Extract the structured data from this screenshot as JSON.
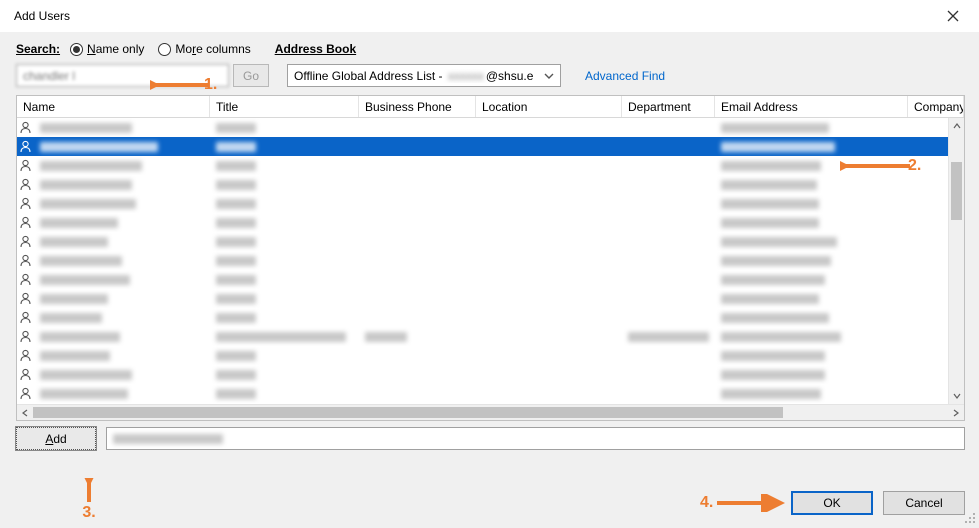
{
  "window": {
    "title": "Add Users"
  },
  "search": {
    "label": "Search:",
    "name_only": "Name only",
    "more_cols": "More columns",
    "address_book_label": "Address Book",
    "input_value": "chandler l",
    "go_label": "Go",
    "ab_select_prefix": "Offline Global Address List - ",
    "ab_select_suffix": "@shsu.e",
    "advanced": "Advanced Find"
  },
  "columns": {
    "name": "Name",
    "title": "Title",
    "phone": "Business Phone",
    "location": "Location",
    "department": "Department",
    "email": "Email Address",
    "company": "Company"
  },
  "rows": [
    {
      "selected": false,
      "widths": {
        "name": 92,
        "title": 40,
        "phone": 0,
        "loc": 0,
        "dept": 0,
        "email": 108
      }
    },
    {
      "selected": true,
      "widths": {
        "name": 118,
        "title": 40,
        "phone": 0,
        "loc": 0,
        "dept": 0,
        "email": 114
      }
    },
    {
      "selected": false,
      "widths": {
        "name": 102,
        "title": 40,
        "phone": 0,
        "loc": 0,
        "dept": 0,
        "email": 100
      }
    },
    {
      "selected": false,
      "widths": {
        "name": 92,
        "title": 40,
        "phone": 0,
        "loc": 0,
        "dept": 0,
        "email": 96
      }
    },
    {
      "selected": false,
      "widths": {
        "name": 96,
        "title": 40,
        "phone": 0,
        "loc": 0,
        "dept": 0,
        "email": 98
      }
    },
    {
      "selected": false,
      "widths": {
        "name": 78,
        "title": 40,
        "phone": 0,
        "loc": 0,
        "dept": 0,
        "email": 98
      }
    },
    {
      "selected": false,
      "widths": {
        "name": 68,
        "title": 40,
        "phone": 0,
        "loc": 0,
        "dept": 0,
        "email": 116
      }
    },
    {
      "selected": false,
      "widths": {
        "name": 82,
        "title": 40,
        "phone": 0,
        "loc": 0,
        "dept": 0,
        "email": 110
      }
    },
    {
      "selected": false,
      "widths": {
        "name": 90,
        "title": 40,
        "phone": 0,
        "loc": 0,
        "dept": 0,
        "email": 104
      }
    },
    {
      "selected": false,
      "widths": {
        "name": 68,
        "title": 40,
        "phone": 0,
        "loc": 0,
        "dept": 0,
        "email": 98
      }
    },
    {
      "selected": false,
      "widths": {
        "name": 62,
        "title": 40,
        "phone": 0,
        "loc": 0,
        "dept": 0,
        "email": 108
      }
    },
    {
      "selected": false,
      "widths": {
        "name": 80,
        "title": 130,
        "phone": 42,
        "loc": 0,
        "dept": 88,
        "email": 120
      }
    },
    {
      "selected": false,
      "widths": {
        "name": 70,
        "title": 40,
        "phone": 0,
        "loc": 0,
        "dept": 0,
        "email": 104
      }
    },
    {
      "selected": false,
      "widths": {
        "name": 92,
        "title": 40,
        "phone": 0,
        "loc": 0,
        "dept": 0,
        "email": 104
      }
    },
    {
      "selected": false,
      "widths": {
        "name": 88,
        "title": 40,
        "phone": 0,
        "loc": 0,
        "dept": 0,
        "email": 100
      }
    }
  ],
  "add": {
    "button_label": "Add",
    "field_value": "Chandler, Laressa"
  },
  "footer": {
    "ok": "OK",
    "cancel": "Cancel"
  },
  "annotations": {
    "a1": "1.",
    "a2": "2.",
    "a3": "3.",
    "a4": "4."
  }
}
